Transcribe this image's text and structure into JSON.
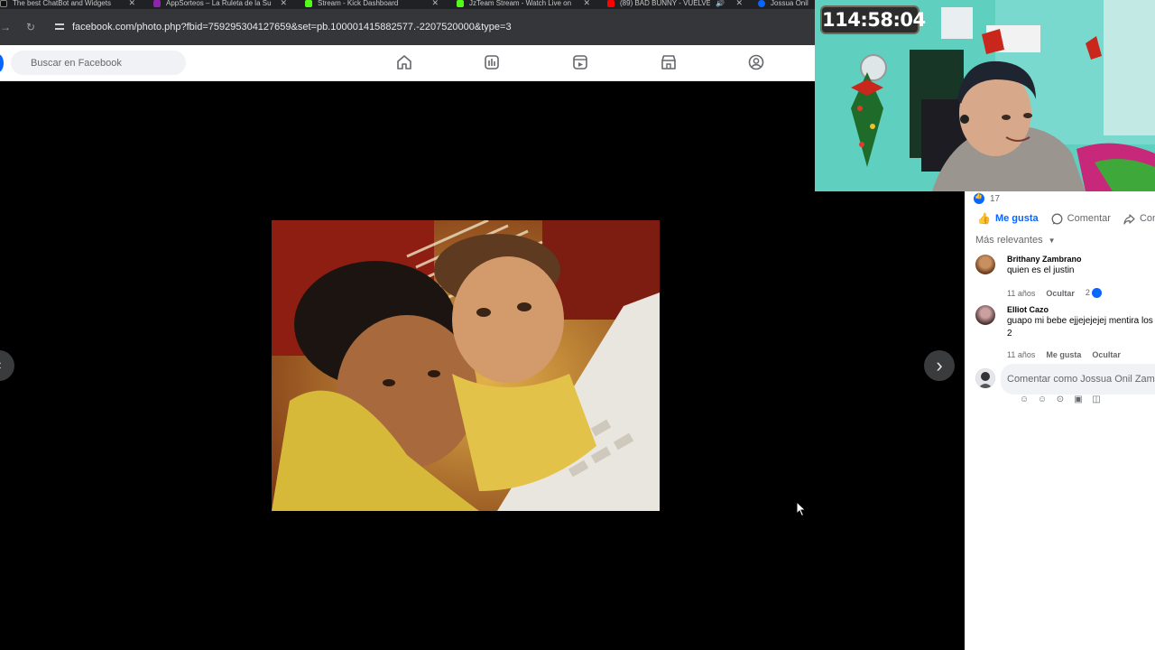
{
  "browser": {
    "tabs": [
      {
        "title": "The best ChatBot and Widgets",
        "color": "#111111"
      },
      {
        "title": "AppSorteos – La Ruleta de la Su",
        "color": "#8e24aa"
      },
      {
        "title": "Stream - Kick Dashboard",
        "color": "#53fc18"
      },
      {
        "title": "JzTeam Stream - Watch Live on",
        "color": "#53fc18"
      },
      {
        "title": "(89) BAD BUNNY - VUELVE",
        "color": "#ff0000"
      },
      {
        "title": "Jossua Onil",
        "color": "#0866ff"
      }
    ],
    "url": "facebook.com/photo.php?fbid=759295304127659&set=pb.100001415882577.-2207520000&type=3"
  },
  "fb": {
    "search_placeholder": "Buscar en Facebook",
    "nav_icons": [
      "home-icon",
      "video-icon",
      "reels-icon",
      "marketplace-icon",
      "groups-icon"
    ]
  },
  "post": {
    "reaction_count": "17",
    "actions": {
      "like": "Me gusta",
      "comment": "Comentar",
      "share": "Com"
    },
    "sort_label": "Más relevantes",
    "comments": [
      {
        "name": "Brithany Zambrano",
        "text": "quien es el justin",
        "time": "11 años",
        "hide": "Ocultar",
        "likes": "2"
      },
      {
        "name": "Elliot Cazo",
        "text": "guapo mi bebe ejjejejejej mentira los 2",
        "time": "11 años",
        "like": "Me gusta",
        "hide": "Ocultar"
      }
    ],
    "compose_placeholder": "Comentar como Jossua Onil Zambr"
  },
  "stream": {
    "timer": "114:58:04"
  }
}
